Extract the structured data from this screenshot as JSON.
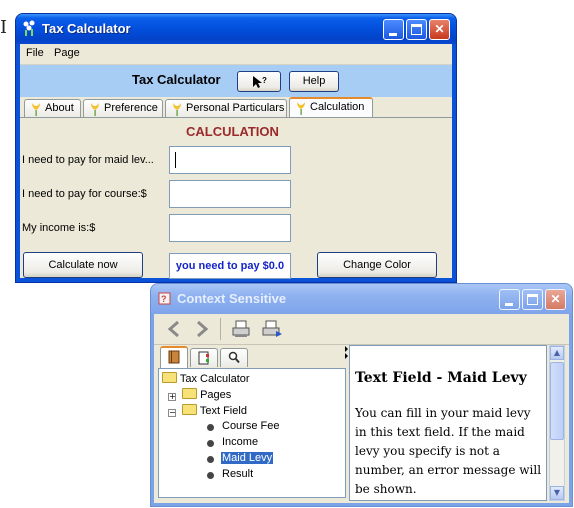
{
  "tax": {
    "title": "Tax Calculator",
    "menu": [
      "File",
      "Page"
    ],
    "banner_title": "Tax Calculator",
    "help_button": "Help",
    "tabs": [
      "About",
      "Preference",
      "Personal Particulars",
      "Calculation"
    ],
    "section_title": "CALCULATION",
    "fields": [
      {
        "label": "I need to pay for maid lev...",
        "value": ""
      },
      {
        "label": "I need to pay for course:$",
        "value": ""
      },
      {
        "label": "My income is:$",
        "value": ""
      }
    ],
    "calculate_button": "Calculate now",
    "result": "you need to pay $0.0",
    "change_color_button": "Change Color"
  },
  "context": {
    "title": "Context Sensitive",
    "tree": [
      {
        "label": "Tax Calculator"
      },
      {
        "label": "Pages"
      },
      {
        "label": "Text Field"
      },
      {
        "label": "Course Fee"
      },
      {
        "label": "Income"
      },
      {
        "label": "Maid Levy"
      },
      {
        "label": "Result"
      }
    ],
    "help_heading": "Text Field - Maid Levy",
    "help_text": "You can fill in your maid levy in this text field. If the maid levy you specify is not a number, an error message will be shown."
  },
  "colors": {
    "banner": "#a8cdf5",
    "section_title": "#9c2a2a",
    "result_text": "#1424c8",
    "selection": "#316ac5"
  }
}
